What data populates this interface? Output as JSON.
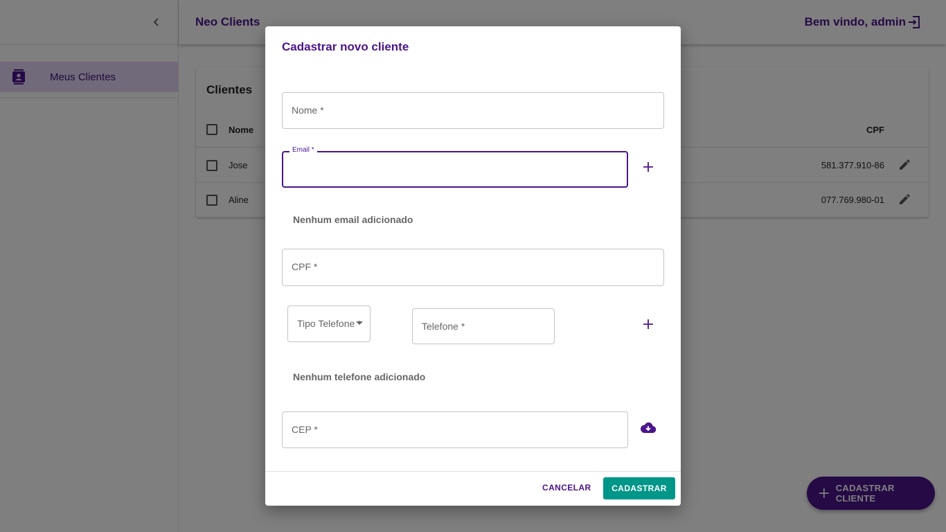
{
  "app": {
    "title": "Neo Clients",
    "welcome": "Bem vindo, admin"
  },
  "sidebar": {
    "items": [
      {
        "label": "Meus Clientes",
        "icon": "contacts-icon",
        "selected": true
      }
    ]
  },
  "clients_card": {
    "title": "Clientes",
    "columns": {
      "name": "Nome",
      "cpf": "CPF"
    },
    "rows": [
      {
        "name": "Jose",
        "cpf": "581.377.910-86"
      },
      {
        "name": "Aline",
        "cpf": "077.769.980-01"
      }
    ]
  },
  "fab": {
    "label": "CADASTRAR CLIENTE",
    "icon": "plus-icon"
  },
  "dialog": {
    "title": "Cadastrar novo cliente",
    "fields": {
      "nome": {
        "placeholder": "Nome *",
        "value": ""
      },
      "email": {
        "label": "Email *",
        "value": ""
      },
      "cpf": {
        "placeholder": "CPF *",
        "value": ""
      },
      "tipo_telefone": {
        "placeholder": "Tipo Telefone *",
        "value": ""
      },
      "telefone": {
        "placeholder": "Telefone *",
        "value": ""
      },
      "cep": {
        "placeholder": "CEP *",
        "value": ""
      }
    },
    "empty_email": "Nenhum email adicionado",
    "empty_telefone": "Nenhum telefone adicionado",
    "actions": {
      "cancel": "CANCELAR",
      "submit": "CADASTRAR"
    }
  },
  "colors": {
    "primary": "#4a148c",
    "accent": "#009688",
    "nav_selected_bg": "#e3d4f7"
  }
}
